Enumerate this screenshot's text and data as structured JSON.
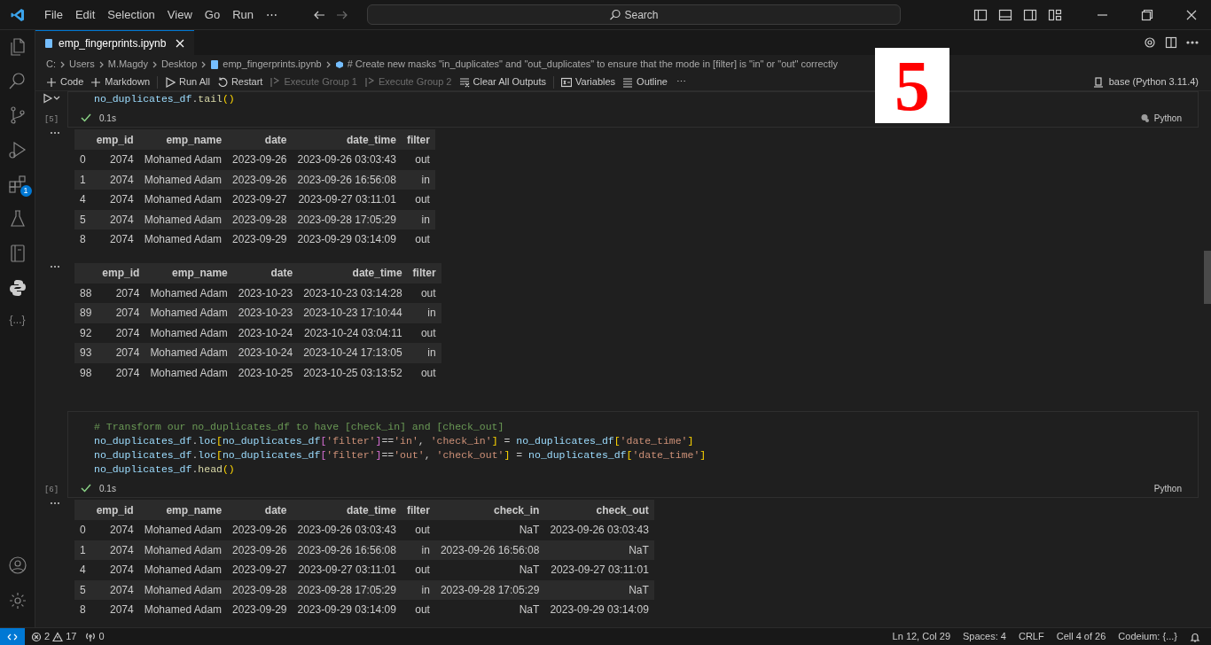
{
  "menu": [
    "File",
    "Edit",
    "Selection",
    "View",
    "Go",
    "Run",
    "⋯"
  ],
  "search": {
    "label": "Search"
  },
  "tab": {
    "title": "emp_fingerprints.ipynb",
    "selected": true
  },
  "breadcrumb": [
    "C:",
    "Users",
    "M.Magdy",
    "Desktop",
    "emp_fingerprints.ipynb",
    "# Create new masks \"in_duplicates\" and \"out_duplicates\" to ensure that the mode in [filter] is \"in\" or \"out\" correctly"
  ],
  "toolbar": [
    {
      "label": "Code",
      "kind": "plus",
      "disabled": false
    },
    {
      "label": "Markdown",
      "kind": "plus",
      "disabled": false
    },
    {
      "label": "Run All",
      "kind": "run",
      "disabled": false
    },
    {
      "label": "Restart",
      "kind": "restart",
      "disabled": false
    },
    {
      "label": "Execute Group 1",
      "kind": "group",
      "disabled": true
    },
    {
      "label": "Execute Group 2",
      "kind": "group",
      "disabled": true
    },
    {
      "label": "Clear All Outputs",
      "kind": "clear",
      "disabled": false
    },
    {
      "label": "Variables",
      "kind": "variables",
      "disabled": false
    },
    {
      "label": "Outline",
      "kind": "outline",
      "disabled": false
    }
  ],
  "toolbar_more": "⋯",
  "kernel": "base (Python 3.11.4)",
  "annotation_badge": "5",
  "activity_bar": {
    "extensions_badge": "1",
    "json_label": "{...}"
  },
  "cells": [
    {
      "exec": "[5]",
      "time": "0.1s",
      "success": true,
      "language": "Python",
      "lines": [
        [
          {
            "kind": "var",
            "t": "no_duplicates_df"
          },
          {
            "kind": "plain",
            "t": "."
          },
          {
            "kind": "fn",
            "t": "tail"
          },
          {
            "kind": "b1",
            "t": "()"
          }
        ]
      ],
      "outputs": [
        {
          "columns": [
            "",
            "emp_id",
            "emp_name",
            "date",
            "date_time",
            "filter"
          ],
          "rows": [
            [
              "0",
              "2074",
              "Mohamed Adam",
              "2023-09-26",
              "2023-09-26 03:03:43",
              "out"
            ],
            [
              "1",
              "2074",
              "Mohamed Adam",
              "2023-09-26",
              "2023-09-26 16:56:08",
              "in"
            ],
            [
              "4",
              "2074",
              "Mohamed Adam",
              "2023-09-27",
              "2023-09-27 03:11:01",
              "out"
            ],
            [
              "5",
              "2074",
              "Mohamed Adam",
              "2023-09-28",
              "2023-09-28 17:05:29",
              "in"
            ],
            [
              "8",
              "2074",
              "Mohamed Adam",
              "2023-09-29",
              "2023-09-29 03:14:09",
              "out"
            ]
          ]
        },
        {
          "columns": [
            "",
            "emp_id",
            "emp_name",
            "date",
            "date_time",
            "filter"
          ],
          "rows": [
            [
              "88",
              "2074",
              "Mohamed Adam",
              "2023-10-23",
              "2023-10-23 03:14:28",
              "out"
            ],
            [
              "89",
              "2074",
              "Mohamed Adam",
              "2023-10-23",
              "2023-10-23 17:10:44",
              "in"
            ],
            [
              "92",
              "2074",
              "Mohamed Adam",
              "2023-10-24",
              "2023-10-24 03:04:11",
              "out"
            ],
            [
              "93",
              "2074",
              "Mohamed Adam",
              "2023-10-24",
              "2023-10-24 17:13:05",
              "in"
            ],
            [
              "98",
              "2074",
              "Mohamed Adam",
              "2023-10-25",
              "2023-10-25 03:13:52",
              "out"
            ]
          ]
        }
      ]
    },
    {
      "exec": "[6]",
      "time": "0.1s",
      "success": true,
      "language": "Python",
      "lines": [
        [
          {
            "kind": "comment",
            "t": "# Transform our no_duplicates_df to have [check_in] and [check_out]"
          }
        ],
        [
          {
            "kind": "var",
            "t": "no_duplicates_df"
          },
          {
            "kind": "plain",
            "t": "."
          },
          {
            "kind": "var",
            "t": "loc"
          },
          {
            "kind": "b1",
            "t": "["
          },
          {
            "kind": "var",
            "t": "no_duplicates_df"
          },
          {
            "kind": "b2",
            "t": "["
          },
          {
            "kind": "str",
            "t": "'filter'"
          },
          {
            "kind": "b2",
            "t": "]"
          },
          {
            "kind": "plain",
            "t": "=="
          },
          {
            "kind": "str",
            "t": "'in'"
          },
          {
            "kind": "plain",
            "t": ", "
          },
          {
            "kind": "str",
            "t": "'check_in'"
          },
          {
            "kind": "b1",
            "t": "]"
          },
          {
            "kind": "plain",
            "t": " = "
          },
          {
            "kind": "var",
            "t": "no_duplicates_df"
          },
          {
            "kind": "b1",
            "t": "["
          },
          {
            "kind": "str",
            "t": "'date_time'"
          },
          {
            "kind": "b1",
            "t": "]"
          }
        ],
        [
          {
            "kind": "var",
            "t": "no_duplicates_df"
          },
          {
            "kind": "plain",
            "t": "."
          },
          {
            "kind": "var",
            "t": "loc"
          },
          {
            "kind": "b1",
            "t": "["
          },
          {
            "kind": "var",
            "t": "no_duplicates_df"
          },
          {
            "kind": "b2",
            "t": "["
          },
          {
            "kind": "str",
            "t": "'filter'"
          },
          {
            "kind": "b2",
            "t": "]"
          },
          {
            "kind": "plain",
            "t": "=="
          },
          {
            "kind": "str",
            "t": "'out'"
          },
          {
            "kind": "plain",
            "t": ", "
          },
          {
            "kind": "str",
            "t": "'check_out'"
          },
          {
            "kind": "b1",
            "t": "]"
          },
          {
            "kind": "plain",
            "t": " = "
          },
          {
            "kind": "var",
            "t": "no_duplicates_df"
          },
          {
            "kind": "b1",
            "t": "["
          },
          {
            "kind": "str",
            "t": "'date_time'"
          },
          {
            "kind": "b1",
            "t": "]"
          }
        ],
        [
          {
            "kind": "var",
            "t": "no_duplicates_df"
          },
          {
            "kind": "plain",
            "t": "."
          },
          {
            "kind": "fn",
            "t": "head"
          },
          {
            "kind": "b1",
            "t": "()"
          }
        ]
      ],
      "outputs": [
        {
          "columns": [
            "",
            "emp_id",
            "emp_name",
            "date",
            "date_time",
            "filter",
            "check_in",
            "check_out"
          ],
          "rows": [
            [
              "0",
              "2074",
              "Mohamed Adam",
              "2023-09-26",
              "2023-09-26 03:03:43",
              "out",
              "NaT",
              "2023-09-26 03:03:43"
            ],
            [
              "1",
              "2074",
              "Mohamed Adam",
              "2023-09-26",
              "2023-09-26 16:56:08",
              "in",
              "2023-09-26 16:56:08",
              "NaT"
            ],
            [
              "4",
              "2074",
              "Mohamed Adam",
              "2023-09-27",
              "2023-09-27 03:11:01",
              "out",
              "NaT",
              "2023-09-27 03:11:01"
            ],
            [
              "5",
              "2074",
              "Mohamed Adam",
              "2023-09-28",
              "2023-09-28 17:05:29",
              "in",
              "2023-09-28 17:05:29",
              "NaT"
            ],
            [
              "8",
              "2074",
              "Mohamed Adam",
              "2023-09-29",
              "2023-09-29 03:14:09",
              "out",
              "NaT",
              "2023-09-29 03:14:09"
            ]
          ]
        }
      ]
    }
  ],
  "status_bar": {
    "errors": "2",
    "warnings": "17",
    "ports": "0",
    "items": [
      "Ln 12, Col 29",
      "Spaces: 4",
      "CRLF",
      "Cell 4 of 26",
      "Codeium: {...}"
    ]
  }
}
